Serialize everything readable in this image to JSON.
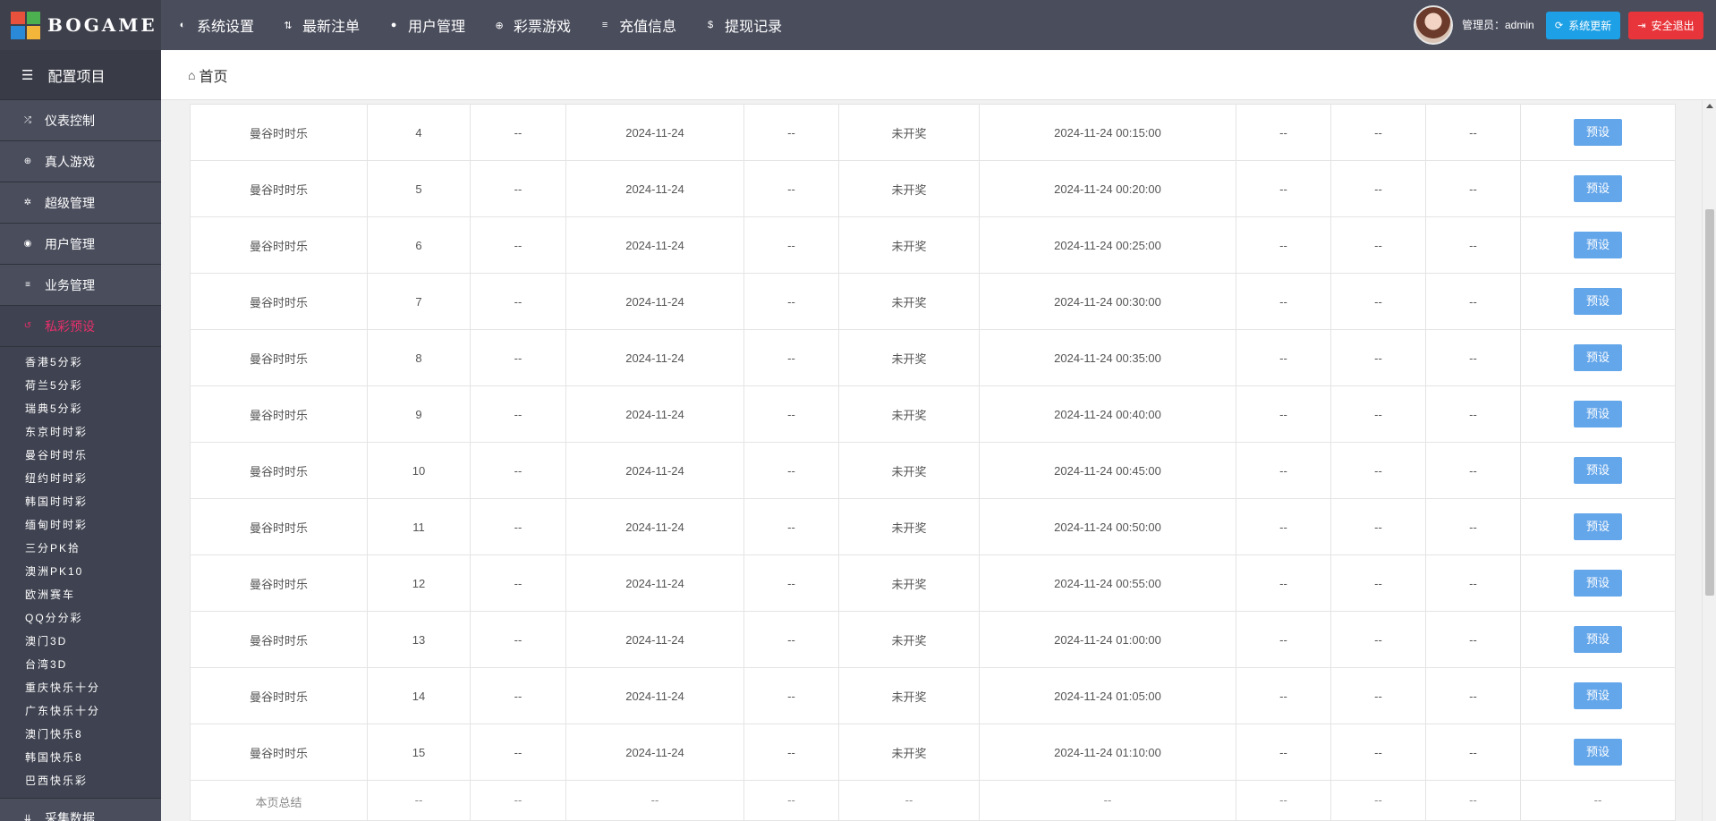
{
  "logo": {
    "text": "BOGAME"
  },
  "topnav": [
    {
      "icon": "◐",
      "label": "系统设置",
      "name": "topnav-system-settings"
    },
    {
      "icon": "⇅",
      "label": "最新注单",
      "name": "topnav-latest-orders"
    },
    {
      "icon": "●",
      "label": "用户管理",
      "name": "topnav-user-management"
    },
    {
      "icon": "⊕",
      "label": "彩票游戏",
      "name": "topnav-lottery-games"
    },
    {
      "icon": "≡",
      "label": "充值信息",
      "name": "topnav-recharge-info"
    },
    {
      "icon": "$",
      "label": "提现记录",
      "name": "topnav-withdraw-records"
    }
  ],
  "header_right": {
    "admin_label": "管理员：admin",
    "update_label": "系统更新",
    "logout_label": "安全退出"
  },
  "sidebar": {
    "header": "配置项目",
    "items": [
      {
        "icon": "⤮",
        "label": "仪表控制"
      },
      {
        "icon": "⊕",
        "label": "真人游戏"
      },
      {
        "icon": "✲",
        "label": "超级管理"
      },
      {
        "icon": "◉",
        "label": "用户管理"
      },
      {
        "icon": "≡",
        "label": "业务管理"
      },
      {
        "icon": "↺",
        "label": "私彩预设"
      }
    ],
    "sub_items": [
      "香港5分彩",
      "荷兰5分彩",
      "瑞典5分彩",
      "东京时时彩",
      "曼谷时时乐",
      "纽约时时彩",
      "韩国时时彩",
      "缅甸时时彩",
      "三分PK拾",
      "澳洲PK10",
      "欧洲赛车",
      "QQ分分彩",
      "澳门3D",
      "台湾3D",
      "重庆快乐十分",
      "广东快乐十分",
      "澳门快乐8",
      "韩国快乐8",
      "巴西快乐彩"
    ],
    "bottom_item": {
      "icon": "⇊",
      "label": "采集数据"
    }
  },
  "breadcrumb": {
    "icon": "⌂",
    "label": "首页"
  },
  "table": {
    "rows": [
      {
        "game": "曼谷时时乐",
        "issue": "4",
        "c3": "--",
        "date": "2024-11-24",
        "c5": "--",
        "status": "未开奖",
        "time": "2024-11-24 00:15:00",
        "c8": "--",
        "c9": "--",
        "c10": "--",
        "action": "预设"
      },
      {
        "game": "曼谷时时乐",
        "issue": "5",
        "c3": "--",
        "date": "2024-11-24",
        "c5": "--",
        "status": "未开奖",
        "time": "2024-11-24 00:20:00",
        "c8": "--",
        "c9": "--",
        "c10": "--",
        "action": "预设"
      },
      {
        "game": "曼谷时时乐",
        "issue": "6",
        "c3": "--",
        "date": "2024-11-24",
        "c5": "--",
        "status": "未开奖",
        "time": "2024-11-24 00:25:00",
        "c8": "--",
        "c9": "--",
        "c10": "--",
        "action": "预设"
      },
      {
        "game": "曼谷时时乐",
        "issue": "7",
        "c3": "--",
        "date": "2024-11-24",
        "c5": "--",
        "status": "未开奖",
        "time": "2024-11-24 00:30:00",
        "c8": "--",
        "c9": "--",
        "c10": "--",
        "action": "预设"
      },
      {
        "game": "曼谷时时乐",
        "issue": "8",
        "c3": "--",
        "date": "2024-11-24",
        "c5": "--",
        "status": "未开奖",
        "time": "2024-11-24 00:35:00",
        "c8": "--",
        "c9": "--",
        "c10": "--",
        "action": "预设"
      },
      {
        "game": "曼谷时时乐",
        "issue": "9",
        "c3": "--",
        "date": "2024-11-24",
        "c5": "--",
        "status": "未开奖",
        "time": "2024-11-24 00:40:00",
        "c8": "--",
        "c9": "--",
        "c10": "--",
        "action": "预设"
      },
      {
        "game": "曼谷时时乐",
        "issue": "10",
        "c3": "--",
        "date": "2024-11-24",
        "c5": "--",
        "status": "未开奖",
        "time": "2024-11-24 00:45:00",
        "c8": "--",
        "c9": "--",
        "c10": "--",
        "action": "预设"
      },
      {
        "game": "曼谷时时乐",
        "issue": "11",
        "c3": "--",
        "date": "2024-11-24",
        "c5": "--",
        "status": "未开奖",
        "time": "2024-11-24 00:50:00",
        "c8": "--",
        "c9": "--",
        "c10": "--",
        "action": "预设"
      },
      {
        "game": "曼谷时时乐",
        "issue": "12",
        "c3": "--",
        "date": "2024-11-24",
        "c5": "--",
        "status": "未开奖",
        "time": "2024-11-24 00:55:00",
        "c8": "--",
        "c9": "--",
        "c10": "--",
        "action": "预设"
      },
      {
        "game": "曼谷时时乐",
        "issue": "13",
        "c3": "--",
        "date": "2024-11-24",
        "c5": "--",
        "status": "未开奖",
        "time": "2024-11-24 01:00:00",
        "c8": "--",
        "c9": "--",
        "c10": "--",
        "action": "预设"
      },
      {
        "game": "曼谷时时乐",
        "issue": "14",
        "c3": "--",
        "date": "2024-11-24",
        "c5": "--",
        "status": "未开奖",
        "time": "2024-11-24 01:05:00",
        "c8": "--",
        "c9": "--",
        "c10": "--",
        "action": "预设"
      },
      {
        "game": "曼谷时时乐",
        "issue": "15",
        "c3": "--",
        "date": "2024-11-24",
        "c5": "--",
        "status": "未开奖",
        "time": "2024-11-24 01:10:00",
        "c8": "--",
        "c9": "--",
        "c10": "--",
        "action": "预设"
      }
    ],
    "summary": [
      "本页总结",
      "--",
      "--",
      "--",
      "--",
      "--",
      "--",
      "--",
      "--",
      "--",
      "--"
    ]
  },
  "colors": {
    "topbar": "#4a4d5c",
    "sidebar": "#3f4250",
    "active": "#e6306b",
    "preset_button": "#64a6ea",
    "update_button": "#1ea0e6",
    "logout_button": "#e8353b"
  }
}
